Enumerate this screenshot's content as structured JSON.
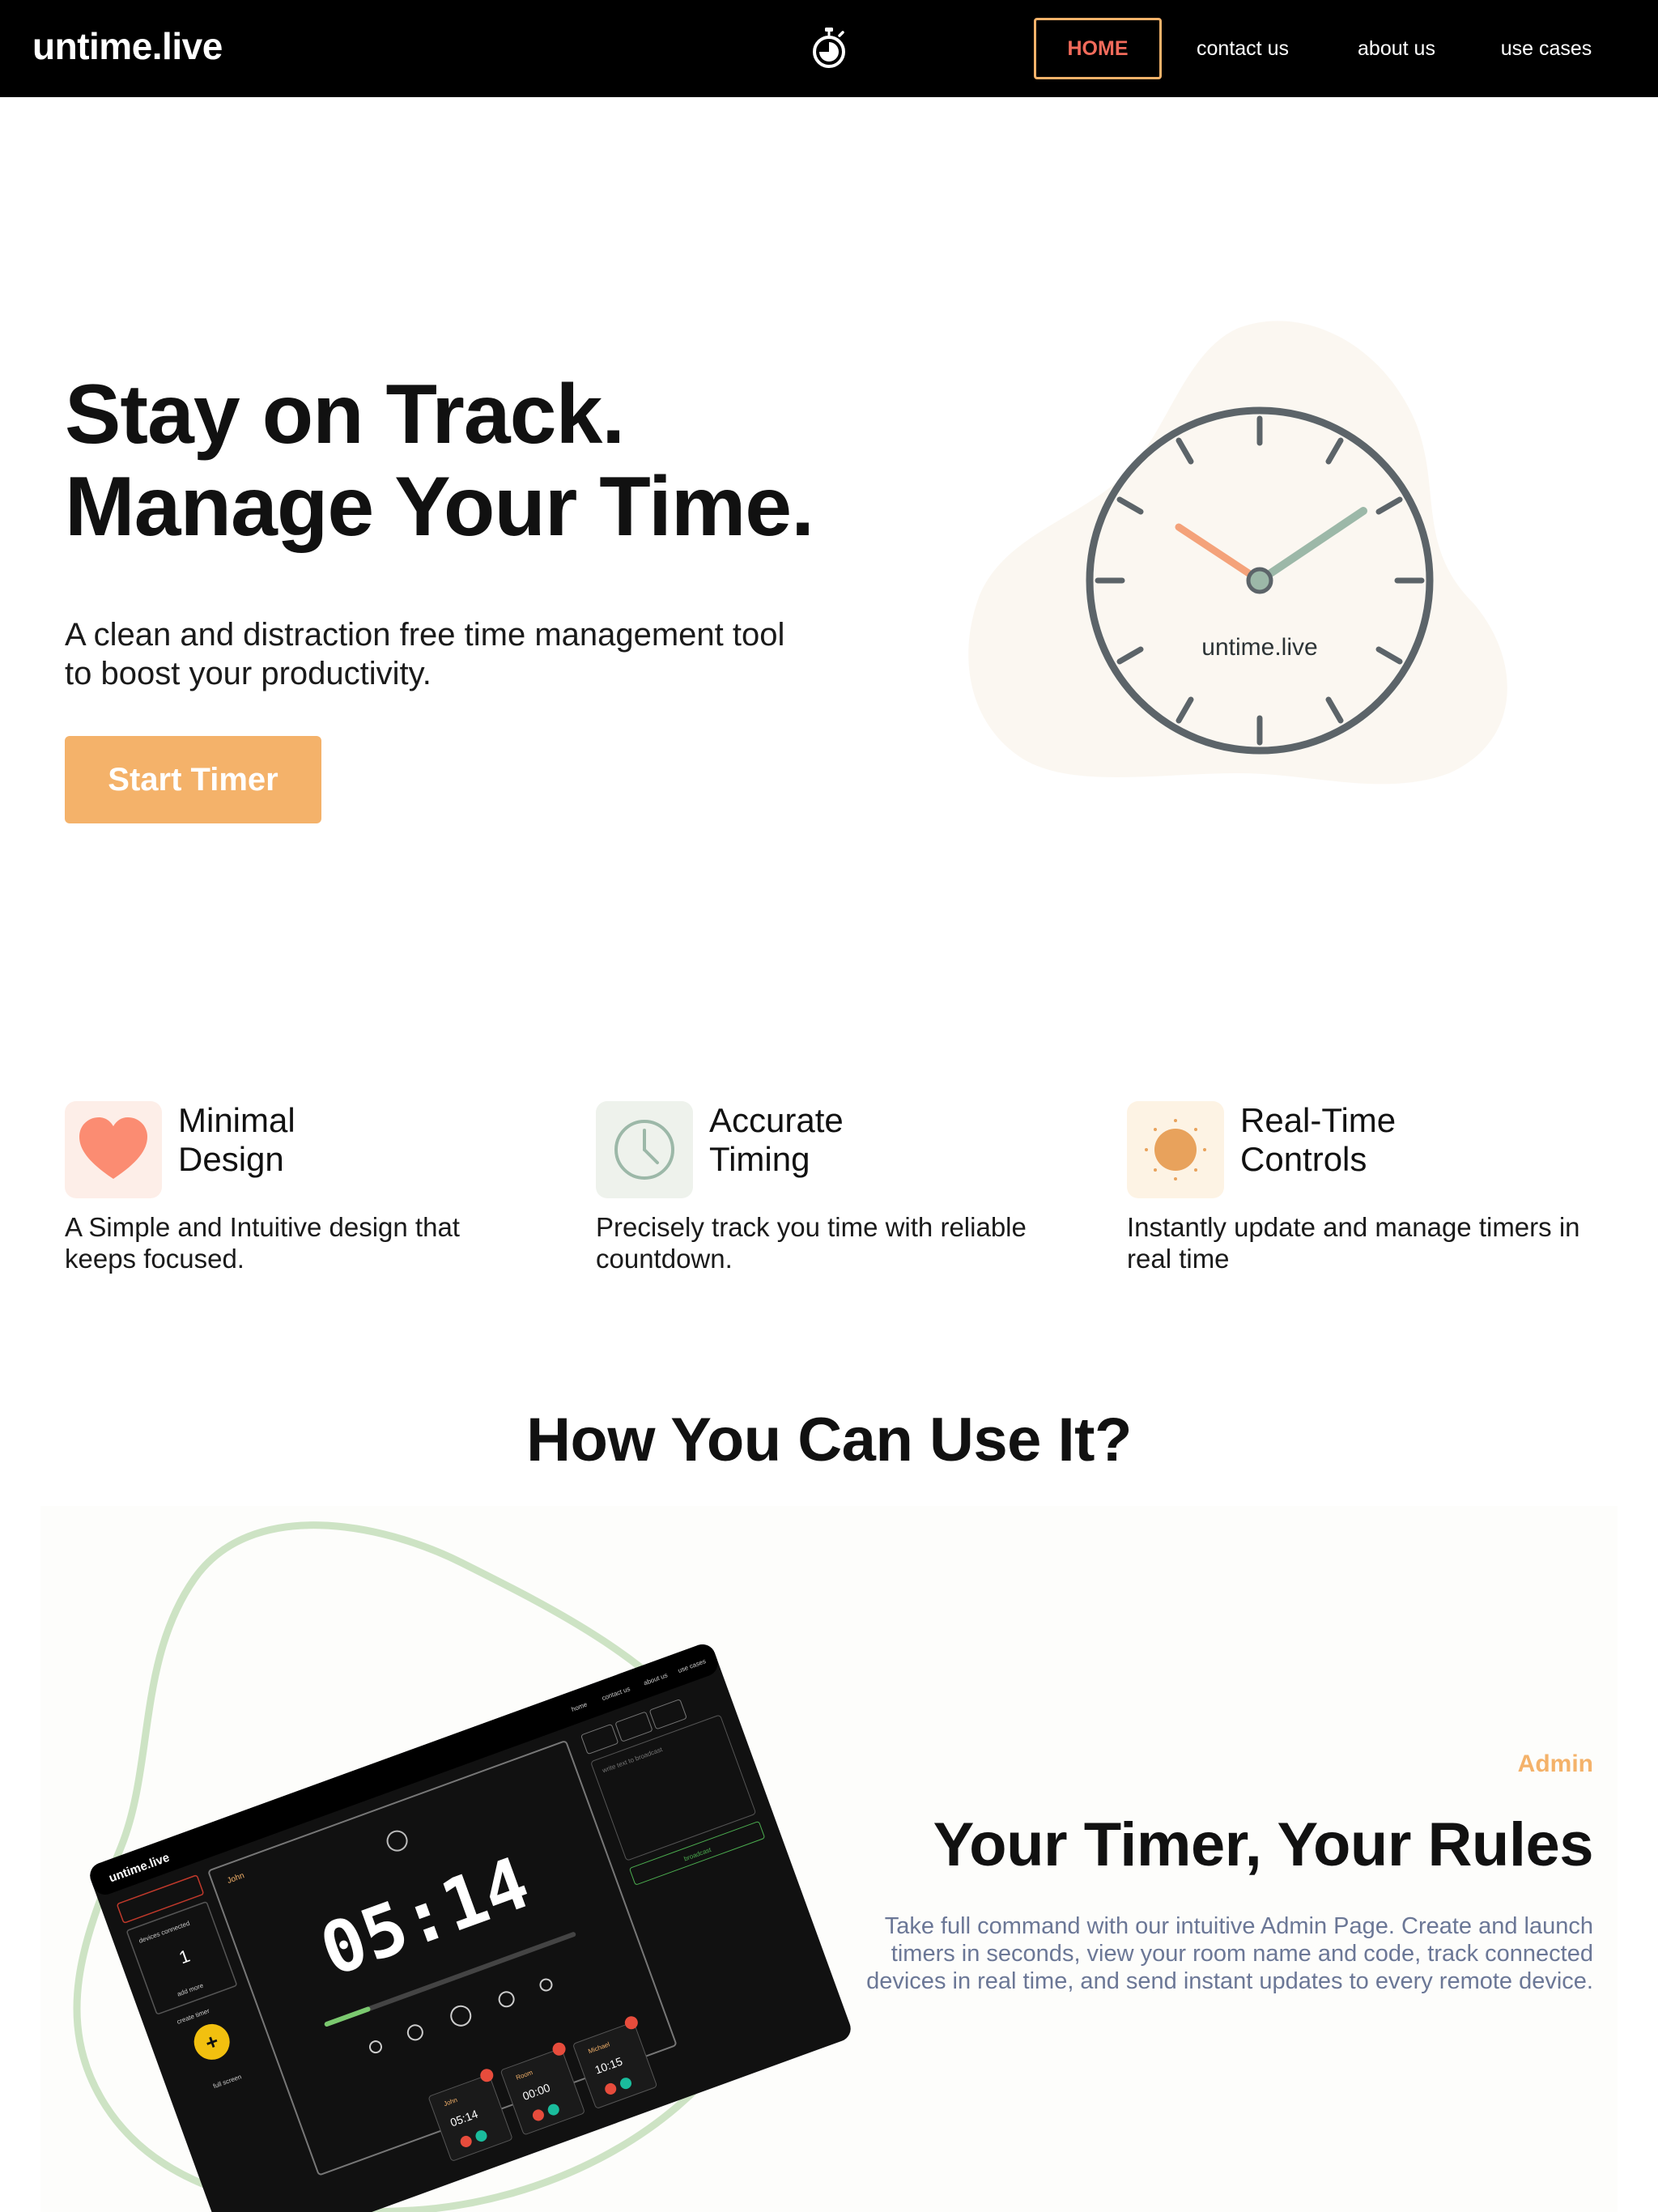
{
  "nav": {
    "brand": "untime.live",
    "links": {
      "home": "HOME",
      "contact": "contact us",
      "about": "about us",
      "use_cases": "use cases"
    }
  },
  "hero": {
    "title_line1": "Stay on Track.",
    "title_line2": "Manage Your Time.",
    "subtitle": "A clean and distraction free time management tool to boost your productivity.",
    "cta": "Start Timer",
    "clock_label": "untime.live"
  },
  "features": [
    {
      "icon": "heart-icon",
      "title_line1": "Minimal",
      "title_line2": "Design",
      "desc": "A Simple and Intuitive design that keeps focused."
    },
    {
      "icon": "clock-icon",
      "title_line1": "Accurate",
      "title_line2": "Timing",
      "desc": "Precisely track you time with reliable countdown."
    },
    {
      "icon": "sun-icon",
      "title_line1": "Real-Time",
      "title_line2": "Controls",
      "desc": "Instantly update and manage timers in real time"
    }
  ],
  "how": {
    "title": "How You Can Use It?",
    "tag": "Admin",
    "headline": "Your Timer, Your Rules",
    "desc": "Take full command with our intuitive Admin Page. Create and launch timers in seconds, view your room name and code, track connected devices in real time, and send instant updates to every remote device.",
    "screenshot": {
      "brand": "untime.live",
      "timer": "05:14",
      "nav_home": "home",
      "nav_contact": "contact us",
      "nav_about": "about us",
      "nav_use": "use cases",
      "name": "John",
      "devices_connected": "devices connected",
      "device_count": "1",
      "add_more": "add more",
      "create_timer": "create timer",
      "full_screen": "full screen",
      "broadcast": "broadcast",
      "message_placeholder": "write text to broadcast",
      "card1_name": "John",
      "card1_time": "05:14",
      "card2_name": "Room",
      "card2_time": "00:00",
      "card3_name": "Michael",
      "card3_time": "10:15"
    }
  },
  "colors": {
    "accent": "#f4b26a",
    "nav_bg": "#000000",
    "home_text": "#f26b5b",
    "heart": "#fb8c72",
    "clock_green": "#9cb8a8",
    "sun": "#e8a25c",
    "desc_gray": "#6b7796",
    "blob_green": "#cde3c4"
  }
}
